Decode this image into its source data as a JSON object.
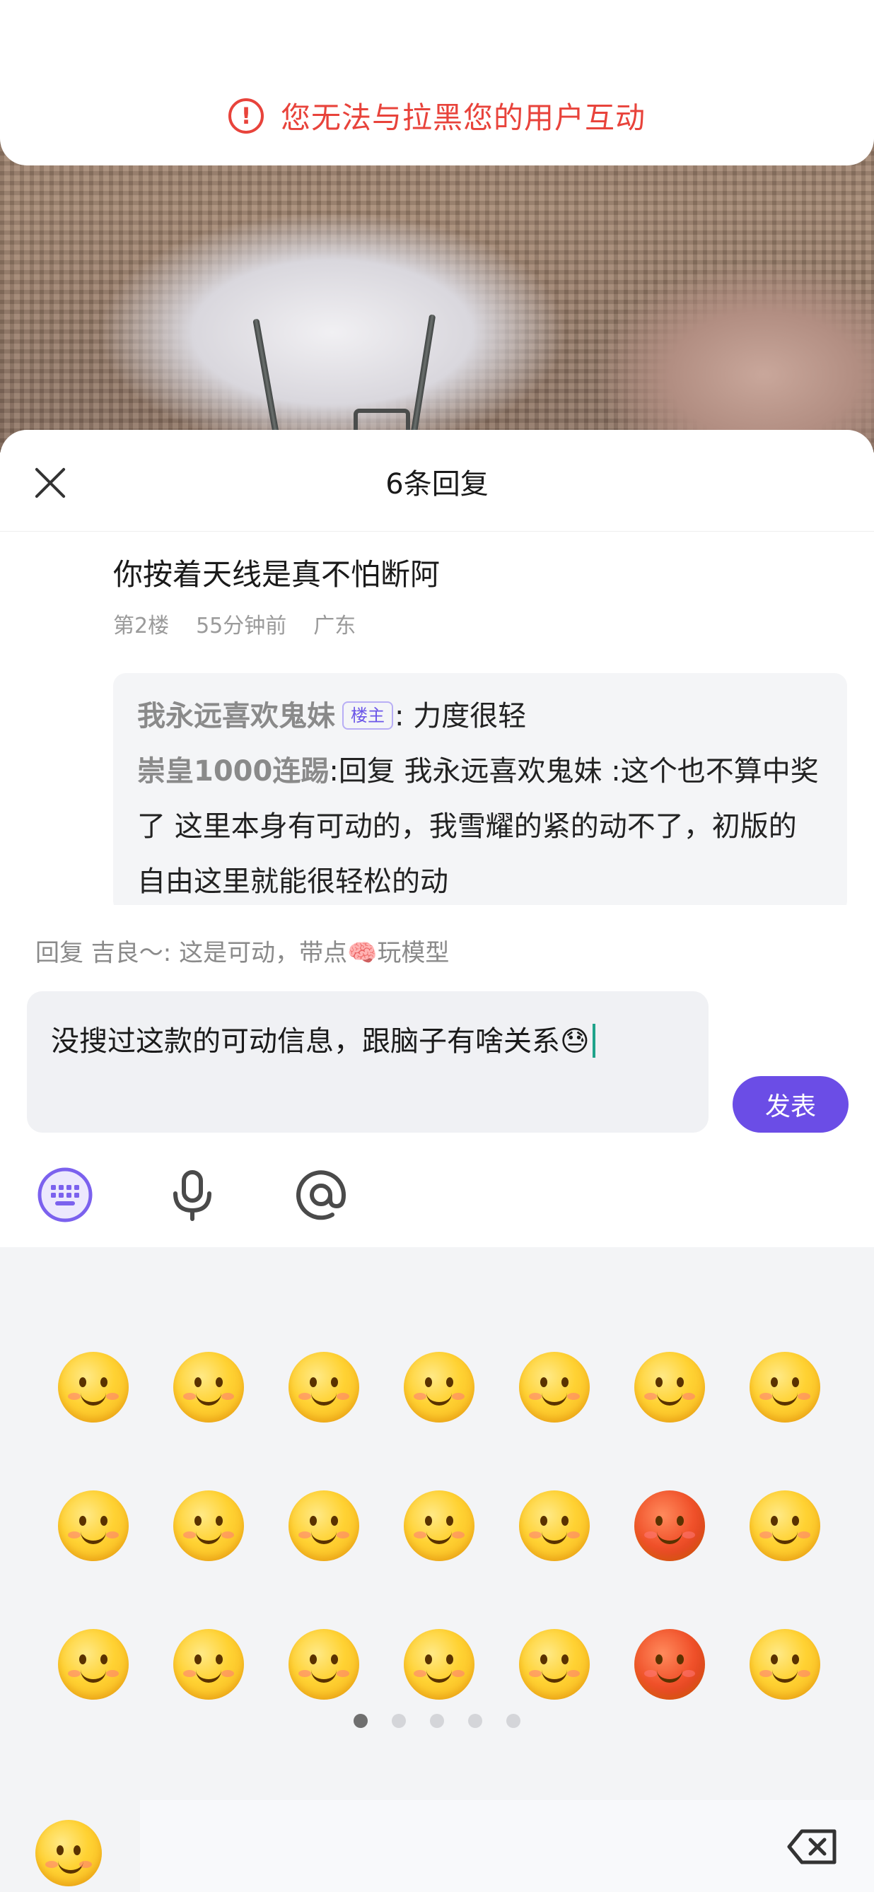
{
  "toast": {
    "icon": "exclamation-circle-icon",
    "message": "您无法与拉黑您的用户互动",
    "color": "#e8433b"
  },
  "sheet": {
    "title": "6条回复",
    "close_icon": "close-icon"
  },
  "post": {
    "text": "你按着天线是真不怕断阿",
    "floor": "第2楼",
    "time": "55分钟前",
    "location": "广东"
  },
  "replies": [
    {
      "author": "我永远喜欢鬼妹",
      "badge": "楼主",
      "separator": ":",
      "text": "力度很轻"
    },
    {
      "author": "崇皇1000连踢",
      "separator": ":",
      "text": "回复 我永远喜欢鬼妹 :这个也不算中奖了 这里本身有可动的，我雪耀的紧的动不了，初版的自由这里就能很轻松的动"
    }
  ],
  "composer": {
    "reply_to": "回复 吉良～: 这是可动，带点🧠玩模型",
    "input_value": "没搜过这款的可动信息，跟脑子有啥关系😓",
    "send_label": "发表",
    "accent": "#6b4de6",
    "tools": [
      "keyboard-icon",
      "microphone-icon",
      "at-icon"
    ]
  },
  "emoji_panel": {
    "rows": [
      [
        "smile",
        "grin-heart",
        "tongue",
        "cover-face",
        "laugh",
        "heart-eyes",
        "pleading"
      ],
      [
        "puppy-eyes",
        "giggle",
        "smirk",
        "toothy-grin",
        "frown",
        "angry-teeth",
        "sweat"
      ],
      [
        "facepalm-line",
        "cry",
        "think-point",
        "spit",
        "shocked-tears",
        "red-smirk",
        "shrug"
      ]
    ],
    "page_count": 5,
    "active_page": 1
  },
  "bottom_bar": {
    "emoji_tab": "smile-emoji-tab",
    "backspace": "backspace-icon"
  }
}
